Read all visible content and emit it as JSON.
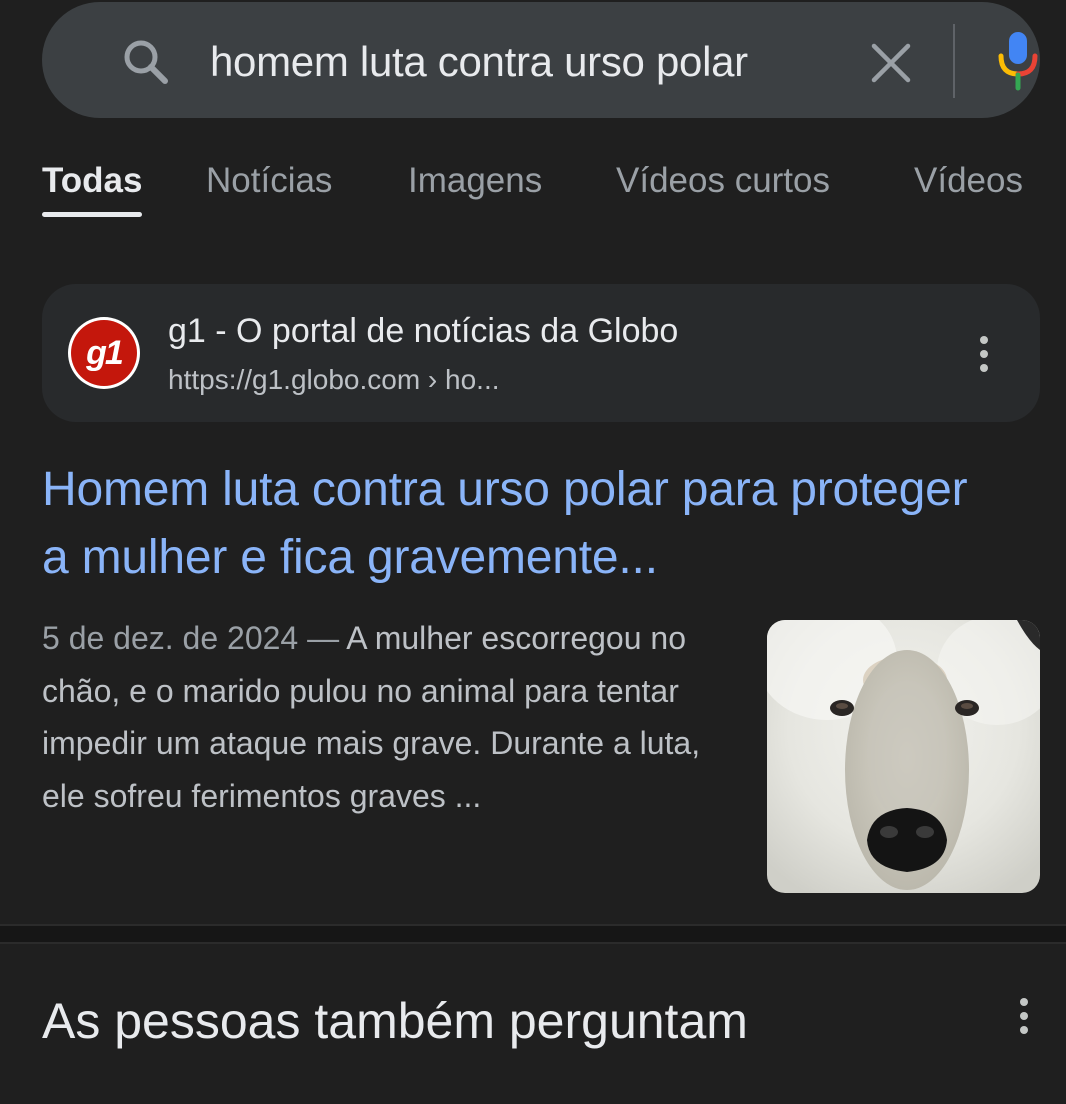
{
  "search": {
    "query": "homem luta contra urso polar",
    "icons": {
      "search": "search-icon",
      "clear": "close-icon",
      "voice": "mic-icon"
    },
    "mic_colors": [
      "#4285f4",
      "#ea4335",
      "#fbbc05",
      "#34a853"
    ]
  },
  "tabs": [
    {
      "label": "Todas",
      "active": true
    },
    {
      "label": "Notícias",
      "active": false
    },
    {
      "label": "Imagens",
      "active": false
    },
    {
      "label": "Vídeos curtos",
      "active": false
    },
    {
      "label": "Vídeos",
      "active": false
    }
  ],
  "result": {
    "favicon_text": "g1",
    "favicon_color": "#c4170c",
    "site_name": "g1 - O portal de notícias da Globo",
    "url": "https://g1.globo.com › ho...",
    "title": "Homem luta contra urso polar para proteger a mulher e fica gravemente...",
    "date": "5 de dez. de 2024",
    "separator": " — ",
    "snippet": "A mulher escorregou no chão, e o marido pulou no animal para tentar impedir um ataque mais grave. Durante a luta, ele sofreu ferimentos graves ...",
    "thumbnail": "polar-bear-face-image",
    "title_color": "#8ab4f8"
  },
  "people_also_ask": {
    "title": "As pessoas também perguntam"
  }
}
